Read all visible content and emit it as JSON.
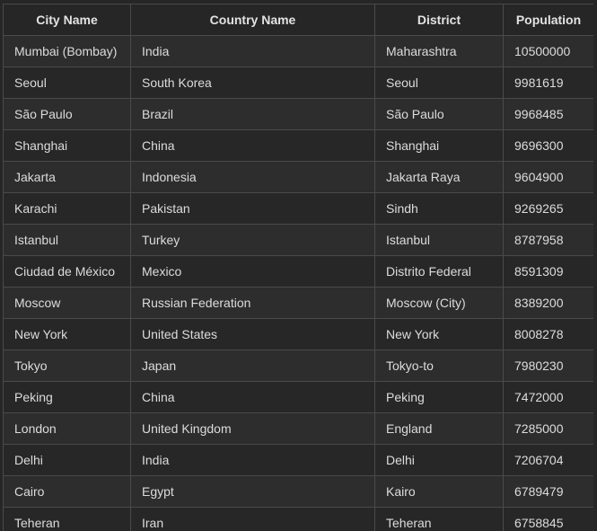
{
  "table": {
    "columns": [
      "City Name",
      "Country Name",
      "District",
      "Population"
    ],
    "rows": [
      [
        "Mumbai (Bombay)",
        "India",
        "Maharashtra",
        "10500000"
      ],
      [
        "Seoul",
        "South Korea",
        "Seoul",
        "9981619"
      ],
      [
        "São Paulo",
        "Brazil",
        "São Paulo",
        "9968485"
      ],
      [
        "Shanghai",
        "China",
        "Shanghai",
        "9696300"
      ],
      [
        "Jakarta",
        "Indonesia",
        "Jakarta Raya",
        "9604900"
      ],
      [
        "Karachi",
        "Pakistan",
        "Sindh",
        "9269265"
      ],
      [
        "Istanbul",
        "Turkey",
        "Istanbul",
        "8787958"
      ],
      [
        "Ciudad de México",
        "Mexico",
        "Distrito Federal",
        "8591309"
      ],
      [
        "Moscow",
        "Russian Federation",
        "Moscow (City)",
        "8389200"
      ],
      [
        "New York",
        "United States",
        "New York",
        "8008278"
      ],
      [
        "Tokyo",
        "Japan",
        "Tokyo-to",
        "7980230"
      ],
      [
        "Peking",
        "China",
        "Peking",
        "7472000"
      ],
      [
        "London",
        "United Kingdom",
        "England",
        "7285000"
      ],
      [
        "Delhi",
        "India",
        "Delhi",
        "7206704"
      ],
      [
        "Cairo",
        "Egypt",
        "Kairo",
        "6789479"
      ],
      [
        "Teheran",
        "Iran",
        "Teheran",
        "6758845"
      ]
    ]
  }
}
